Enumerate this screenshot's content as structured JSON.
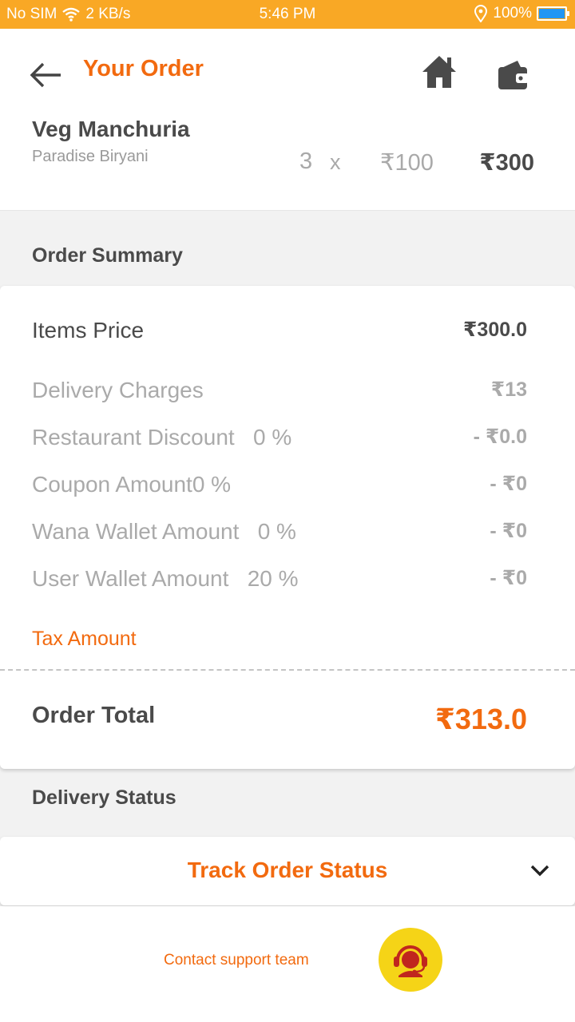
{
  "status_bar": {
    "carrier": "No SIM",
    "speed": "2 KB/s",
    "time": "5:46 PM",
    "battery": "100%",
    "icons": [
      "wifi-icon",
      "location-icon",
      "battery-icon"
    ]
  },
  "header": {
    "title": "Your Order",
    "icons": [
      "back-arrow-icon",
      "home-icon",
      "wallet-icon"
    ]
  },
  "order_item": {
    "name": "Veg Manchuria",
    "restaurant": "Paradise Biryani",
    "quantity": "3",
    "multiplier": "x",
    "unit_price": "₹100",
    "total": "₹300"
  },
  "order_summary": {
    "title": "Order Summary",
    "rows": [
      {
        "label": "Items Price",
        "value": "₹300.0"
      },
      {
        "label": "Delivery Charges",
        "value": "₹13"
      },
      {
        "label": "Restaurant Discount   0 %",
        "value": "- ₹0.0"
      },
      {
        "label": "Coupon Amount0 %",
        "value": "- ₹0"
      },
      {
        "label": "Wana Wallet Amount   0 %",
        "value": "- ₹0"
      },
      {
        "label": "User Wallet Amount   20 %",
        "value": "- ₹0"
      }
    ],
    "tax_label": "Tax Amount",
    "total_label": "Order Total",
    "total_value": "₹313.0"
  },
  "delivery": {
    "title": "Delivery Status",
    "track_label": "Track Order Status"
  },
  "support": {
    "label": "Contact support team"
  },
  "colors": {
    "accent": "#f26a0f",
    "status_bar": "#f9a825",
    "support_button": "#f5d417"
  }
}
